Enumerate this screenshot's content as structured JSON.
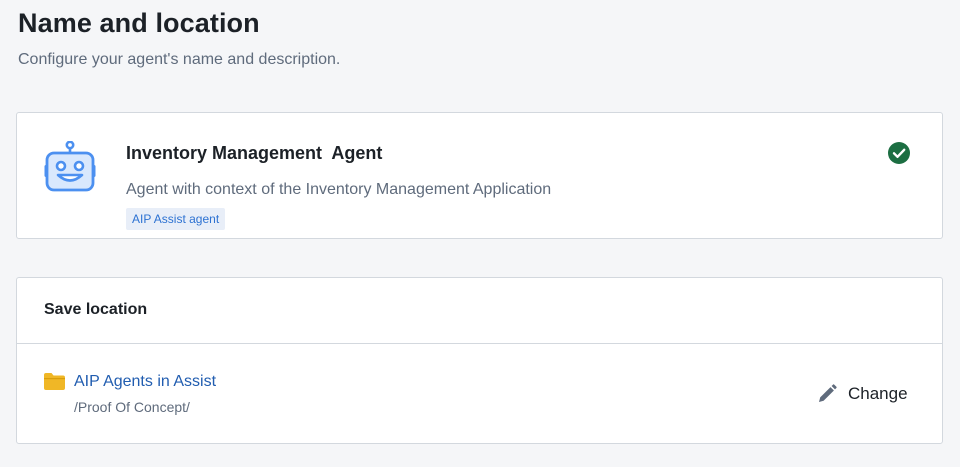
{
  "header": {
    "title": "Name and location",
    "subtitle": "Configure your agent's name and description."
  },
  "agent": {
    "name": "Inventory Management  Agent",
    "description": "Agent with context of the Inventory Management Application",
    "tag": "AIP Assist agent",
    "icon": "robot-icon",
    "status_icon": "check-circle-icon",
    "status_color": "#1c6e42",
    "icon_color": "#4c90f0"
  },
  "location": {
    "header": "Save location",
    "folder_name": "AIP Agents in Assist",
    "folder_path": "/Proof Of Concept/",
    "folder_icon": "folder-icon",
    "folder_color": "#f0b726",
    "change_label": "Change",
    "change_icon": "pencil-icon"
  }
}
